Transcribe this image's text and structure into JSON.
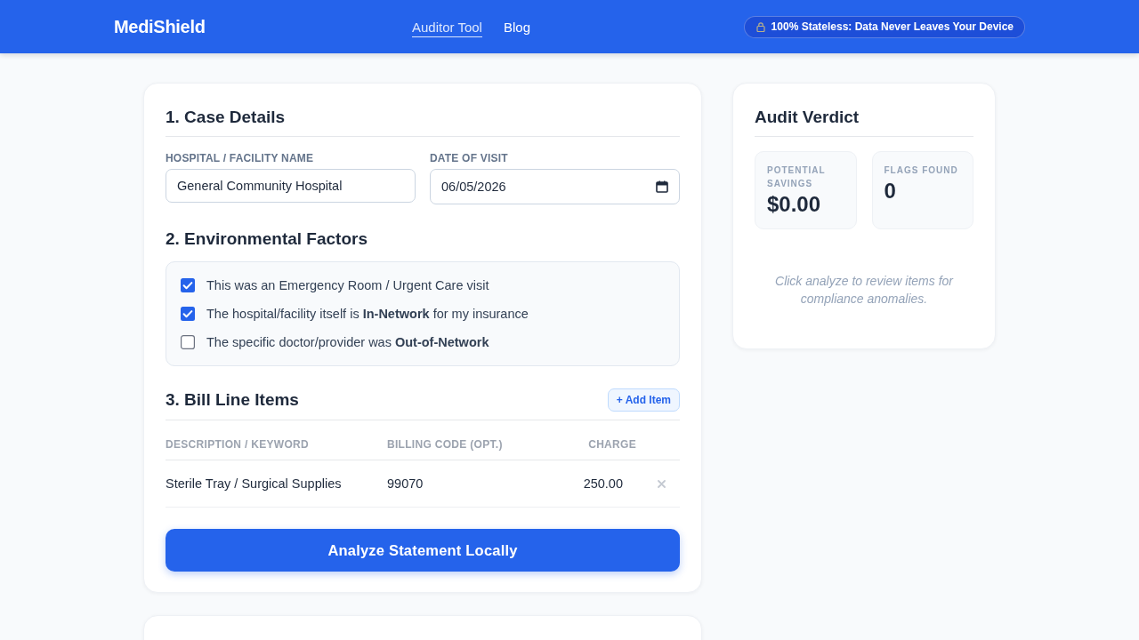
{
  "header": {
    "logo": "MediShield",
    "nav": [
      {
        "label": "Auditor Tool",
        "selected": true
      },
      {
        "label": "Blog",
        "selected": false
      }
    ],
    "badge": "100% Stateless: Data Never Leaves Your Device"
  },
  "case_details": {
    "title": "1. Case Details",
    "fields": [
      {
        "kind": "text",
        "label": "HOSPITAL / FACILITY NAME",
        "value": "General Community Hospital"
      },
      {
        "kind": "date",
        "label": "DATE OF VISIT",
        "value": "06/05/2026"
      }
    ]
  },
  "environmental_factors": {
    "title": "2. Environmental Factors",
    "options": [
      {
        "label": "This was an Emergency Room / Urgent Care visit",
        "checked": true
      },
      {
        "label": "The hospital/facility itself is **In-Network** for my insurance",
        "checked": true
      },
      {
        "label": "The specific doctor/provider was **Out-of-Network**",
        "checked": false
      }
    ]
  },
  "bill_line_items": {
    "title": "3. Bill Line Items",
    "add_button": "+ Add Item",
    "columns": [
      "DESCRIPTION / KEYWORD",
      "BILLING CODE (OPT.)",
      "CHARGE"
    ],
    "rows": [
      {
        "description": "Sterile Tray / Surgical Supplies",
        "billing_code": "99070",
        "charge": "250.00"
      }
    ]
  },
  "analyze_button": "Analyze Statement Locally",
  "audit_verdict": {
    "title": "Audit Verdict",
    "stats": [
      {
        "label": "POTENTIAL SAVINGS",
        "value": "$0.00"
      },
      {
        "label": "FLAGS FOUND",
        "value": "0"
      }
    ],
    "hint": "Click analyze to review items for compliance anomalies."
  }
}
